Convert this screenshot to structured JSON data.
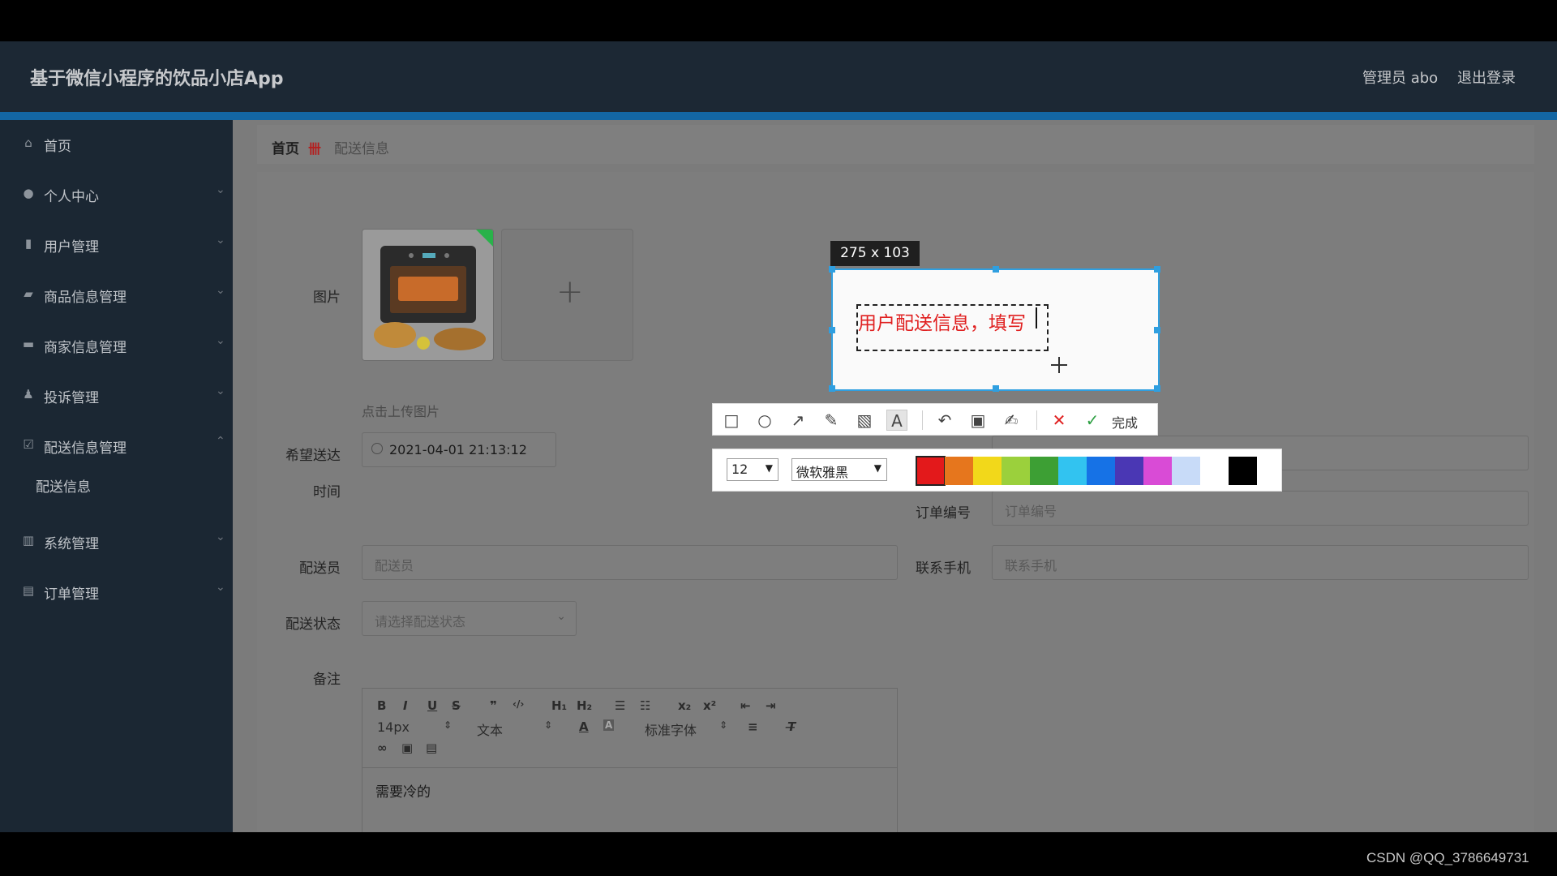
{
  "header": {
    "title": "基于微信小程序的饮品小店App",
    "admin": "管理员 abo",
    "logout": "退出登录"
  },
  "sidebar": {
    "items": [
      {
        "label": "首页",
        "icon": "home-icon"
      },
      {
        "label": "个人中心",
        "icon": "user-icon"
      },
      {
        "label": "用户管理",
        "icon": "users-icon"
      },
      {
        "label": "商品信息管理",
        "icon": "goods-icon"
      },
      {
        "label": "商家信息管理",
        "icon": "shop-icon"
      },
      {
        "label": "投诉管理",
        "icon": "complaint-icon"
      },
      {
        "label": "配送信息管理",
        "icon": "delivery-icon"
      },
      {
        "label": "系统管理",
        "icon": "chart-icon"
      },
      {
        "label": "订单管理",
        "icon": "order-icon"
      }
    ],
    "sub": "配送信息"
  },
  "breadcrumb": {
    "home": "首页",
    "separator": "卌",
    "current": "配送信息"
  },
  "form": {
    "image_label": "图片",
    "upload_hint": "点击上传图片",
    "time_label_1": "希望送达",
    "time_label_2": "时间",
    "time_value": "2021-04-01 21:13:12",
    "courier_label": "配送员",
    "courier_placeholder": "配送员",
    "status_label": "配送状态",
    "status_placeholder": "请选择配送状态",
    "order_label": "订单编号",
    "order_placeholder": "订单编号",
    "phone_label": "联系手机",
    "phone_placeholder": "联系手机",
    "note_label": "备注",
    "note_content": "需要冷的"
  },
  "editor_toolbar": {
    "bold": "B",
    "italic": "I",
    "underline": "U",
    "strike": "S",
    "quote": "❞",
    "code": "‹/›",
    "h1": "H₁",
    "h2": "H₂",
    "ol": "☰",
    "ul": "☷",
    "sub": "x₂",
    "sup": "x²",
    "outdent": "⇤",
    "indent": "⇥",
    "size": "14px",
    "block": "文本",
    "font": "标准字体"
  },
  "screenshot_tool": {
    "size": "275 x 103",
    "typed_text": "用户配送信息，填写",
    "done": "完成",
    "font_size": "12",
    "font_name": "微软雅黑",
    "colors": [
      "#e3191b",
      "#e6761d",
      "#f2d81a",
      "#9bd03c",
      "#3d9f34",
      "#32c3f0",
      "#1672e6",
      "#4a37b4",
      "#d94bd6",
      "#c8dbf8",
      "#ffffff",
      "#000000"
    ],
    "selected_color": "#e3191b"
  },
  "watermark": "CSDN @QQ_3786649731"
}
